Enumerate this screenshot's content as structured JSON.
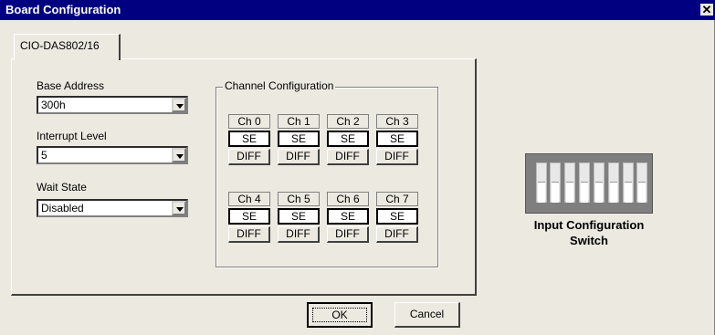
{
  "window": {
    "title": "Board Configuration",
    "close_glyph": "✕"
  },
  "tab": {
    "label": "CIO-DAS802/16"
  },
  "base_address": {
    "label": "Base Address",
    "value": "300h"
  },
  "interrupt_level": {
    "label": "Interrupt Level",
    "value": "5"
  },
  "wait_state": {
    "label": "Wait State",
    "value": "Disabled"
  },
  "channel_config": {
    "title": "Channel Configuration",
    "channels": [
      {
        "name": "Ch 0",
        "se": "SE",
        "diff": "DIFF"
      },
      {
        "name": "Ch 1",
        "se": "SE",
        "diff": "DIFF"
      },
      {
        "name": "Ch 2",
        "se": "SE",
        "diff": "DIFF"
      },
      {
        "name": "Ch 3",
        "se": "SE",
        "diff": "DIFF"
      },
      {
        "name": "Ch 4",
        "se": "SE",
        "diff": "DIFF"
      },
      {
        "name": "Ch 5",
        "se": "SE",
        "diff": "DIFF"
      },
      {
        "name": "Ch 6",
        "se": "SE",
        "diff": "DIFF"
      },
      {
        "name": "Ch 7",
        "se": "SE",
        "diff": "DIFF"
      }
    ]
  },
  "switch": {
    "label_line1": "Input Configuration",
    "label_line2": "Switch"
  },
  "buttons": {
    "ok": "OK",
    "cancel": "Cancel"
  }
}
